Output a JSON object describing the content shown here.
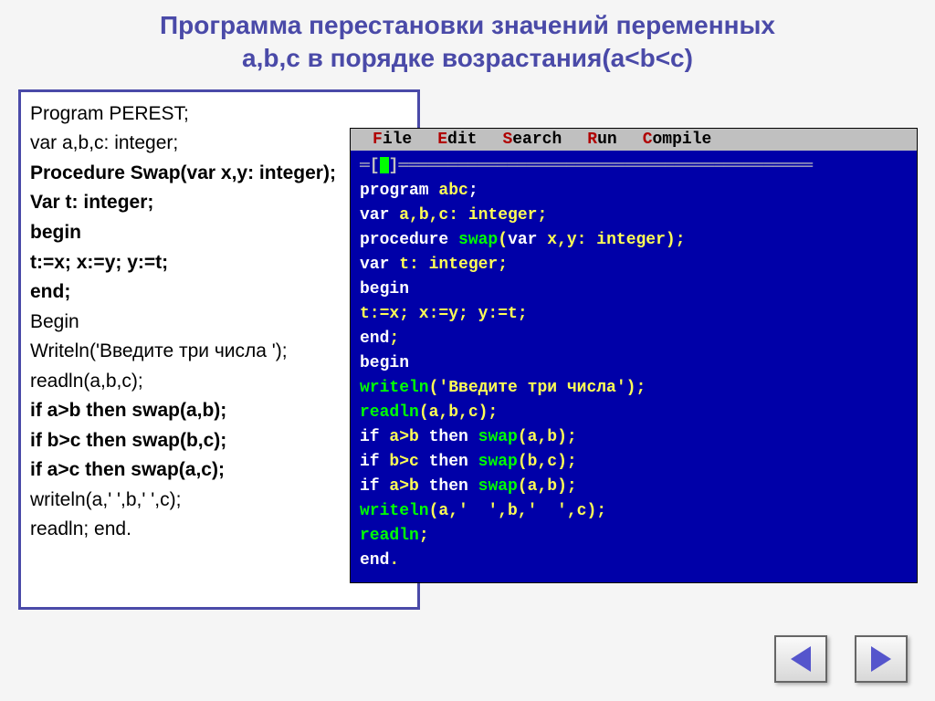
{
  "title_line1": "Программа перестановки значений переменных",
  "title_line2": "a,b,c в порядке возрастания(a<b<c)",
  "left_code": {
    "l1": "Program PEREST;",
    "l2": "var a,b,c: integer;",
    "l3": "Procedure Swap(var x,y: integer);",
    "l4": "Var t: integer;",
    "l5": "begin",
    "l6": "t:=x; x:=y; y:=t;",
    "l7": "end;",
    "l8": "Begin",
    "l9": "Writeln('Введите три числа ');",
    "l10": "readln(a,b,c);",
    "l11": "if a>b then swap(a,b);",
    "l12": "if b>c then swap(b,c);",
    "l13": "if a>c then swap(a,c);",
    "l14": "writeln(a,' ',b,' ',c);",
    "l15": "readln;  end."
  },
  "ide_menu": {
    "file": {
      "hk": "F",
      "rest": "ile"
    },
    "edit": {
      "hk": "E",
      "rest": "dit"
    },
    "search": {
      "hk": "S",
      "rest": "earch"
    },
    "run": {
      "hk": "R",
      "rest": "un"
    },
    "compile": {
      "hk": "C",
      "rest": "ompile"
    }
  },
  "ide_code": {
    "l1_a": "program ",
    "l1_b": "abc",
    "l2_a": "var ",
    "l2_b": "a,b,c: integer;",
    "l3_a": "procedure ",
    "l3_b": "swap",
    "l3_c": "(",
    "l3_d": "var ",
    "l3_e": "x,y: integer);",
    "l4_a": "var ",
    "l4_b": "t: integer;",
    "l5": "begin",
    "l6": "t:=x; x:=y; y:=t;",
    "l7_a": "end",
    "l7_b": ";",
    "l8": "begin",
    "l9_a": "writeln",
    "l9_b": "('Введите три числа');",
    "l10_a": "readln",
    "l10_b": "(a,b,c);",
    "l11_a": "if ",
    "l11_b": "a>b ",
    "l11_c": "then ",
    "l11_d": "swap",
    "l11_e": "(a,b);",
    "l12_a": "if ",
    "l12_b": "b>c ",
    "l12_c": "then ",
    "l12_d": "swap",
    "l12_e": "(b,c);",
    "l13_a": "if ",
    "l13_b": "a>b ",
    "l13_c": "then ",
    "l13_d": "swap",
    "l13_e": "(a,b);",
    "l14_a": "writeln",
    "l14_b": "(a,'  ',b,'  ',c);",
    "l15_a": "readln",
    "l15_b": ";",
    "l16_a": "end",
    "l16_b": "."
  },
  "icons": {
    "prev": "prev",
    "next": "next"
  }
}
